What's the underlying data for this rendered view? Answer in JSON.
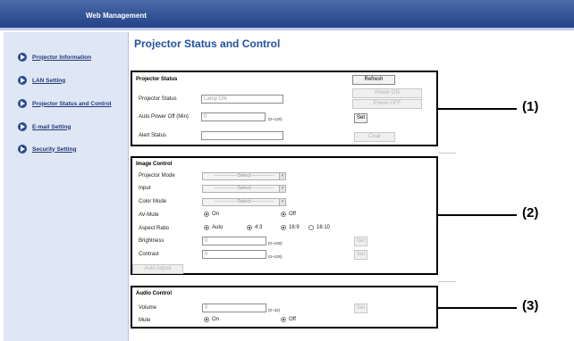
{
  "header": {
    "title": "Web Management"
  },
  "sidebar": {
    "items": [
      {
        "label": "Projector Information"
      },
      {
        "label": "LAN Setting"
      },
      {
        "label": "Projector Status and Control"
      },
      {
        "label": "E-mail Setting"
      },
      {
        "label": "Security Setting"
      }
    ]
  },
  "main": {
    "title": "Projector Status and Control"
  },
  "status": {
    "title": "Projector Status",
    "refresh": "Refresh",
    "power_on": "Power ON",
    "power_off": "Power OFF",
    "projector_status_label": "Projector Status",
    "projector_status_value": "Lamp ON",
    "auto_power_off_label": "Auto Power Off (Min)",
    "auto_power_off_value": "0",
    "auto_power_off_range": "(0~120)",
    "set": "Set",
    "alert_label": "Alert Status",
    "clear": "Clear"
  },
  "image": {
    "title": "Image Control",
    "projector_mode_label": "Projector Mode",
    "input_label": "Input",
    "color_mode_label": "Color Mode",
    "select_placeholder": "--------------Select--------------",
    "av_mute_label": "AV-Mute",
    "on": "On",
    "off": "Off",
    "aspect_label": "Aspect Ratio",
    "aspect_auto": "Auto",
    "aspect_43": "4:3",
    "aspect_169": "16:9",
    "aspect_1610": "16:10",
    "brightness_label": "Brightness",
    "brightness_value": "0",
    "contrast_label": "Contrast",
    "contrast_value": "0",
    "range_0_100": "(0~100)",
    "set": "Set",
    "auto_adjust": "Auto Adjust"
  },
  "audio": {
    "title": "Audio Control",
    "volume_label": "Volume",
    "volume_value": "0",
    "volume_range": "(0~32)",
    "set": "Set",
    "mute_label": "Mute",
    "on": "On",
    "off": "Off"
  },
  "callouts": [
    "(1)",
    "(2)",
    "(3)"
  ]
}
